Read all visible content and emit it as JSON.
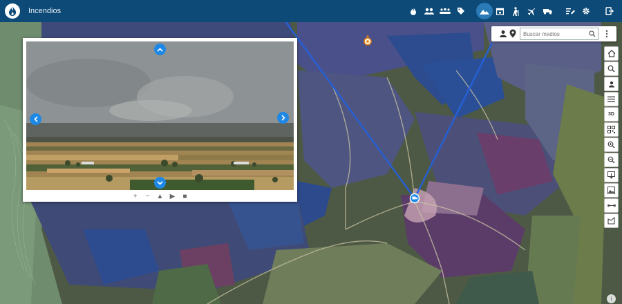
{
  "app": {
    "title": "Incendios"
  },
  "topbar": {
    "icons": [
      "fire-icon",
      "people-icon",
      "group-icon",
      "tag-icon",
      "mountain-icon",
      "calendar-icon",
      "hiker-icon",
      "plane-icon",
      "truck-icon",
      "edit-list-icon",
      "gear-icon",
      "logout-icon"
    ],
    "active": "mountain-icon"
  },
  "search": {
    "placeholder": "Buscar medios"
  },
  "camera": {
    "controls": [
      "+",
      "−",
      "▲",
      "▶",
      "■"
    ]
  },
  "sidebar": {
    "labels": {
      "3d": "3D"
    }
  },
  "info": {
    "label": "i"
  },
  "colors": {
    "topbar": "#0d4a77",
    "accent": "#1e88e5",
    "sightline": "#2560d8"
  }
}
